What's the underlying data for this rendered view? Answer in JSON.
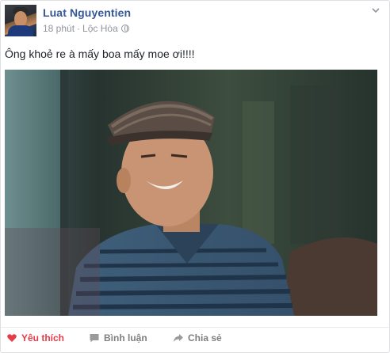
{
  "post": {
    "author": "Luat Nguyentien",
    "time": "18 phút",
    "separator": "·",
    "location": "Lộc Hòa",
    "text": "Ông khoẻ re à mấy boa mấy moe ơi!!!!"
  },
  "actions": {
    "like_label": "Yêu thích",
    "comment_label": "Bình luận",
    "share_label": "Chia sẻ"
  },
  "colors": {
    "author": "#365899",
    "meta": "#90949c",
    "like_active": "#e63c4a",
    "action": "#7f7f7f"
  },
  "icons": {
    "options": "chevron-down-icon",
    "privacy": "globe-icon",
    "like": "heart-icon",
    "comment": "comment-icon",
    "share": "share-arrow-icon"
  }
}
